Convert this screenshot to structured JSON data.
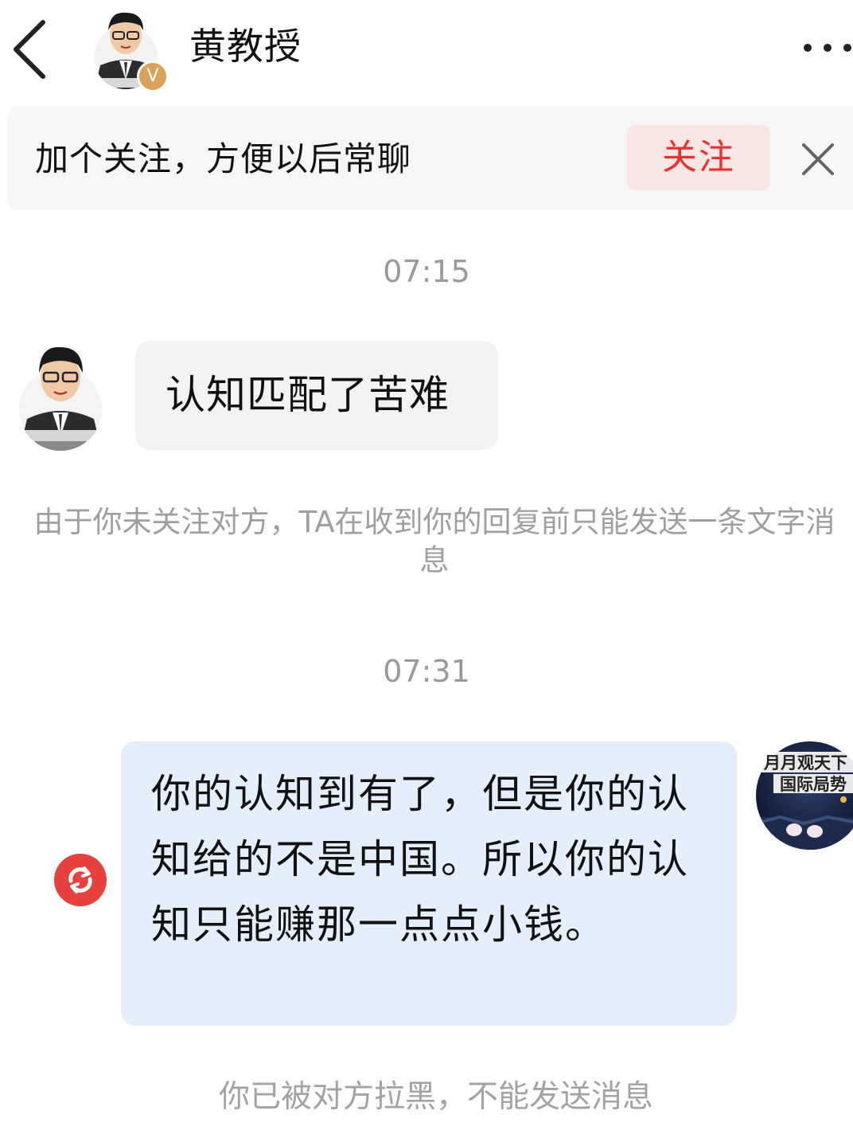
{
  "header": {
    "title": "黄教授",
    "verified_badge": "V"
  },
  "follow_banner": {
    "text": "加个关注，方便以后常聊",
    "follow_label": "关注"
  },
  "messages": {
    "ts1": "07:15",
    "incoming_text": "认知匹配了苦难",
    "notice_1": "由于你未关注对方，TA在收到你的回复前只能发送一条文字消息",
    "ts2": "07:31",
    "outgoing_text": "你的认知到有了，但是你的认知给的不是中国。所以你的认知只能赚那一点点小钱。",
    "notice_2": "你已被对方拉黑，不能发送消息"
  },
  "self_avatar_text": {
    "line1": "月月观天下",
    "line2": "国际局势"
  },
  "icons": {
    "back": "chevron-left-icon",
    "more": "more-dots-icon",
    "close": "close-icon",
    "resend": "resend-icon"
  },
  "colors": {
    "accent_red": "#e5342f",
    "follow_bg": "#fbe6e6",
    "outgoing_bubble": "#e5effc",
    "incoming_bubble": "#f3f3f3",
    "badge_gold": "#d9a35b"
  }
}
